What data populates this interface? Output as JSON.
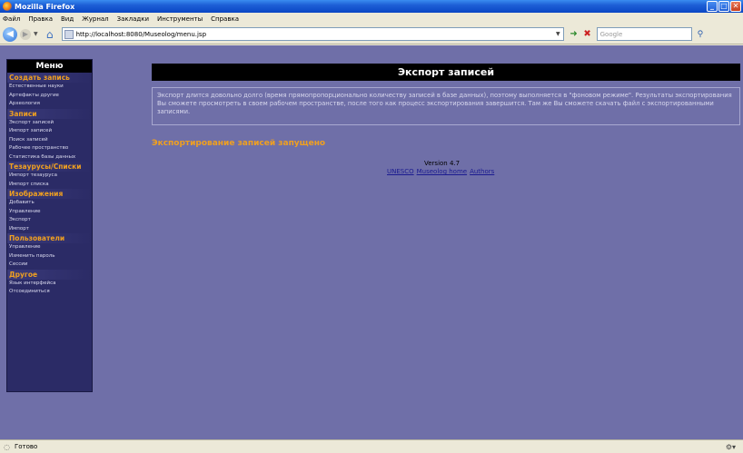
{
  "window": {
    "title": "Mozilla Firefox"
  },
  "menubar": [
    "Файл",
    "Правка",
    "Вид",
    "Журнал",
    "Закладки",
    "Инструменты",
    "Справка"
  ],
  "navbar": {
    "url": "http://localhost:8080/Museolog/menu.jsp",
    "search_placeholder": "Google"
  },
  "sidebar": {
    "title": "Меню",
    "groups": [
      {
        "label": "Создать запись",
        "items": [
          "Естественные науки",
          "Артефакты другие",
          "Археология"
        ]
      },
      {
        "label": "Записи",
        "items": [
          "Экспорт записей",
          "Импорт записей",
          "Поиск записей",
          "Рабочее пространство",
          "Статистика базы данных"
        ]
      },
      {
        "label": "Тезаурусы/Списки",
        "items": [
          "Импорт тезауруса",
          "Импорт списка"
        ]
      },
      {
        "label": "Изображения",
        "items": [
          "Добавить",
          "Управление",
          "Экспорт",
          "Импорт"
        ]
      },
      {
        "label": "Пользователи",
        "items": [
          "Управление",
          "Изменить пароль",
          "Сессии"
        ]
      },
      {
        "label": "Другое",
        "items": [
          "Язык интерфейса",
          "Отсоединиться"
        ]
      }
    ]
  },
  "main": {
    "header": "Экспорт записей",
    "notice": "Экспорт длится довольно долго (время прямопропорционально количеству записей в базе данных), поэтому выполняется в \"фоновом режиме\". Результаты экспортирования Вы сможете просмотреть в своем рабочем пространстве, после того как процесс экспортирования завершится. Там же Вы сможете скачать файл с экспортированными записями.",
    "status_message": "Экспортирование записей запущено",
    "version": "Version 4.7",
    "links": [
      "UNESCO",
      "Museolog home",
      "Authors"
    ]
  },
  "statusbar": {
    "text": "Готово"
  },
  "colors": {
    "page_bg": "#6f6fa8",
    "sidebar_bg": "#2b2b66",
    "accent": "#f0a020",
    "header_bg": "#000000"
  }
}
